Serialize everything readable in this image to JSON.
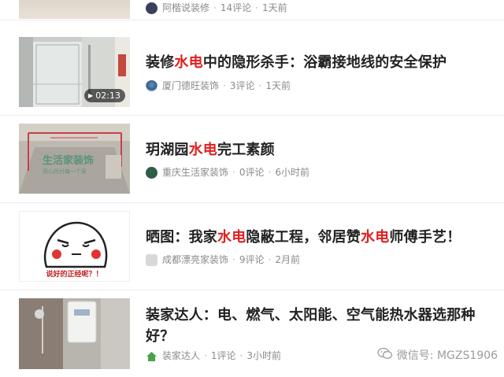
{
  "items": [
    {
      "title_parts": [],
      "author": "阿楷说装修",
      "comments": "14评论",
      "time": "1天前",
      "duration": ""
    },
    {
      "title_parts": [
        "装修",
        "水电",
        "中的隐形杀手：浴霸接地线的安全保护"
      ],
      "author": "厦门德旺装饰",
      "comments": "3评论",
      "time": "1天前",
      "duration": "02:13"
    },
    {
      "title_parts": [
        "玥湖园",
        "水电",
        "完工素颜"
      ],
      "author": "重庆生活家装饰",
      "comments": "0评论",
      "time": "6小时前",
      "duration": "",
      "thumb_text": "生活家装饰",
      "thumb_subtext": "用心托付每一个家"
    },
    {
      "title_parts": [
        "晒图：我家",
        "水电",
        "隐蔽工程，邻居赞",
        "水电",
        "师傅手艺！"
      ],
      "author": "成都漂亮家装饰",
      "comments": "9评论",
      "time": "2月前",
      "duration": "",
      "thumb_caption": "说好的正经呢？！"
    },
    {
      "title_parts": [
        "装家达人：电、燃气、太阳能、空气能热水器选那种好？"
      ],
      "author": "装家达人",
      "comments": "1评论",
      "time": "3小时前",
      "duration": ""
    }
  ],
  "watermark": {
    "icon": "wechat-icon",
    "text": "微信号: MGZS1906"
  },
  "colors": {
    "highlight": "#e02020",
    "meta": "#8a8a8a"
  }
}
